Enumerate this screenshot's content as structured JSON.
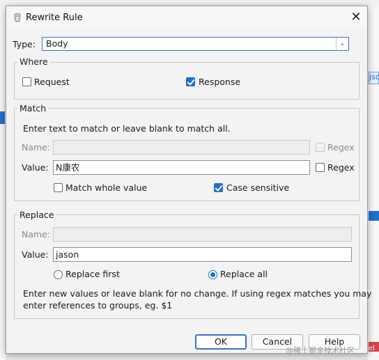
{
  "background": {
    "right_tab_fragment": "jsc",
    "right_bottom_fragment": "el"
  },
  "dialog": {
    "title": "Rewrite Rule",
    "close_glyph": "✕",
    "type_label": "Type:",
    "type_value": "Body",
    "where": {
      "title": "Where",
      "request_label": "Request",
      "request_checked": false,
      "response_label": "Response",
      "response_checked": true
    },
    "match": {
      "title": "Match",
      "hint": "Enter text to match or leave blank to match all.",
      "name_label": "Name:",
      "name_value": "",
      "name_regex_label": "Regex",
      "value_label": "Value:",
      "value_value": "N康农",
      "value_regex_label": "Regex",
      "match_whole_label": "Match whole value",
      "match_whole_checked": false,
      "case_sensitive_label": "Case sensitive",
      "case_sensitive_checked": true
    },
    "replace": {
      "title": "Replace",
      "name_label": "Name:",
      "name_value": "",
      "value_label": "Value:",
      "value_value": "jason",
      "replace_first_label": "Replace first",
      "replace_all_label": "Replace all",
      "selected_mode": "Replace all",
      "help_text_line1": "Enter new values or leave blank for no change. If using regex matches you may",
      "help_text_line2": "enter references to groups, eg. $1"
    },
    "buttons": {
      "ok": "OK",
      "cancel": "Cancel",
      "help": "Help"
    }
  },
  "watermark": "@稀土掘金技术社区",
  "colors": {
    "accent": "#1f6fd1",
    "focus_border": "#3b6fcf"
  }
}
